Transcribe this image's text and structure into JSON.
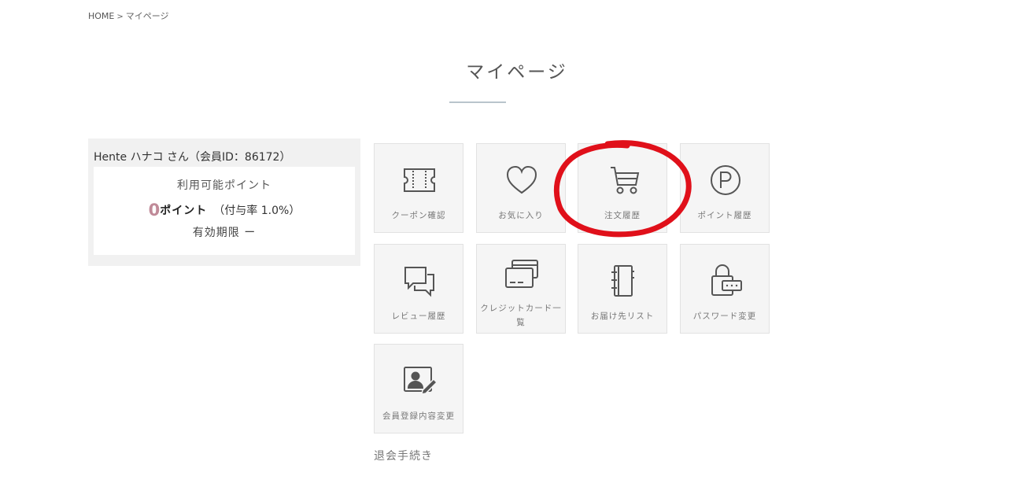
{
  "breadcrumb": {
    "home": "HOME",
    "separator": ">",
    "current": "マイページ"
  },
  "page": {
    "title": "マイページ"
  },
  "member": {
    "name": "Hente ハナコ さん（会員ID：86172）",
    "points_label": "利用可能ポイント",
    "points_value": "0",
    "points_unit": "ポイント",
    "rate_text": "（付与率 1.0%）",
    "expiry_text": "有効期限 ー"
  },
  "menu": {
    "coupon": {
      "label": "クーポン確認",
      "icon": "coupon-icon"
    },
    "favorites": {
      "label": "お気に入り",
      "icon": "heart-icon"
    },
    "order_history": {
      "label": "注文履歴",
      "icon": "cart-icon"
    },
    "point_history": {
      "label": "ポイント履歴",
      "icon": "point-p-icon"
    },
    "review_history": {
      "label": "レビュー履歴",
      "icon": "speech-bubbles-icon"
    },
    "credit_cards": {
      "label": "クレジットカード一覧",
      "icon": "credit-card-icon"
    },
    "address_list": {
      "label": "お届け先リスト",
      "icon": "address-book-icon"
    },
    "password_change": {
      "label": "パスワード変更",
      "icon": "lock-password-icon"
    },
    "member_info_change": {
      "label": "会員登録内容変更",
      "icon": "profile-edit-icon"
    }
  },
  "withdraw": {
    "label": "退会手続き"
  },
  "colors": {
    "accent_points": "#c08a98",
    "annotation": "#e0101a",
    "tile_bg": "#f5f5f5"
  }
}
